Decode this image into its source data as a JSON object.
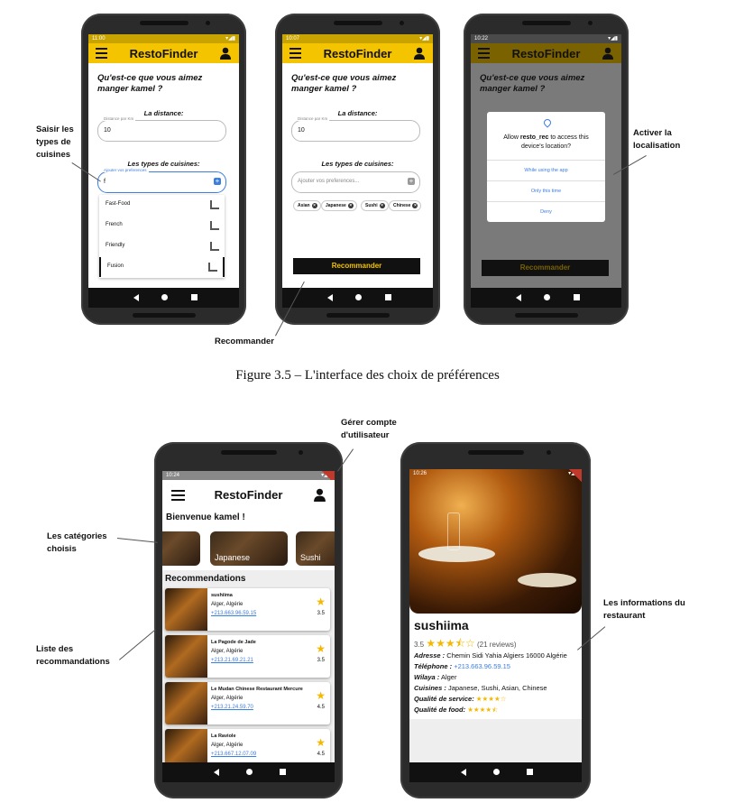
{
  "app_title": "RestoFinder",
  "question": "Qu'est-ce que vous aimez manger kamel ?",
  "distance_label": "La distance:",
  "distance_caption": "Distance par Km",
  "distance_value": "10",
  "cuisines_label": "Les types de cuisines:",
  "pref_caption": "Ajouter vos preferences",
  "pref_input": "f",
  "pref_placeholder": "Ajouter vos preferences...",
  "dropdown": [
    "Fast-Food",
    "French",
    "Friendly",
    "Fusion"
  ],
  "chips": [
    "Asian",
    "Japanese",
    "Sushi",
    "Chinese"
  ],
  "recommend_button": "Recommander",
  "times": [
    "11:00",
    "10:07",
    "10:22",
    "10:24",
    "10:26"
  ],
  "dialog": {
    "msg_pre": "Allow ",
    "app": "resto_rec",
    "msg_post": " to access this device's location?",
    "options": [
      "While using the app",
      "Only this time",
      "Deny"
    ]
  },
  "annotations": {
    "saisir": "Saisir les types de cuisines",
    "recommander": "Recommander",
    "activer": "Activer la localisation",
    "gerer": "Gérer compte d'utilisateur",
    "categories": "Les catégories choisis",
    "liste": "Liste des recommandations",
    "infos": "Les informations du restaurant"
  },
  "caption": "Figure 3.5 – L'interface des choix de préférences",
  "home": {
    "welcome": "Bienvenue kamel !",
    "categories": [
      "",
      "Japanese",
      "Sushi"
    ],
    "section": "Recommendations",
    "items": [
      {
        "name": "sushiima",
        "city": "Alger, Algérie",
        "phone": "+213.663.96.59.15",
        "rating": "3.5"
      },
      {
        "name": "La Pagode de Jade",
        "city": "Alger, Algérie",
        "phone": "+213.21.69.21.21",
        "rating": "3.5"
      },
      {
        "name": "Le Mudan Chinese Restaurant Mercure",
        "city": "Alger, Algérie",
        "phone": "+213.21.24.59.70",
        "rating": "4.5"
      },
      {
        "name": "La Raviole",
        "city": "Alger, Algérie",
        "phone": "+213.667.12.07.09",
        "rating": "4.5"
      }
    ]
  },
  "detail": {
    "name": "sushiima",
    "rating": "3.5",
    "stars": "★★★⯪☆",
    "reviews": "(21 reviews)",
    "address_label": "Adresse :",
    "address": "Chemin Sidi Yahia Algiers 16000 Algérie",
    "phone_label": "Téléphone :",
    "phone": "+213.663.96.59.15",
    "wilaya_label": "Wilaya :",
    "wilaya": "Alger",
    "cuisines_label": "Cuisines :",
    "cuisines": "Japanese, Sushi, Asian, Chinese",
    "service_label": "Qualité de service:",
    "service_stars": "★★★★☆",
    "food_label": "Qualité de food:",
    "food_stars": "★★★★⯪"
  }
}
